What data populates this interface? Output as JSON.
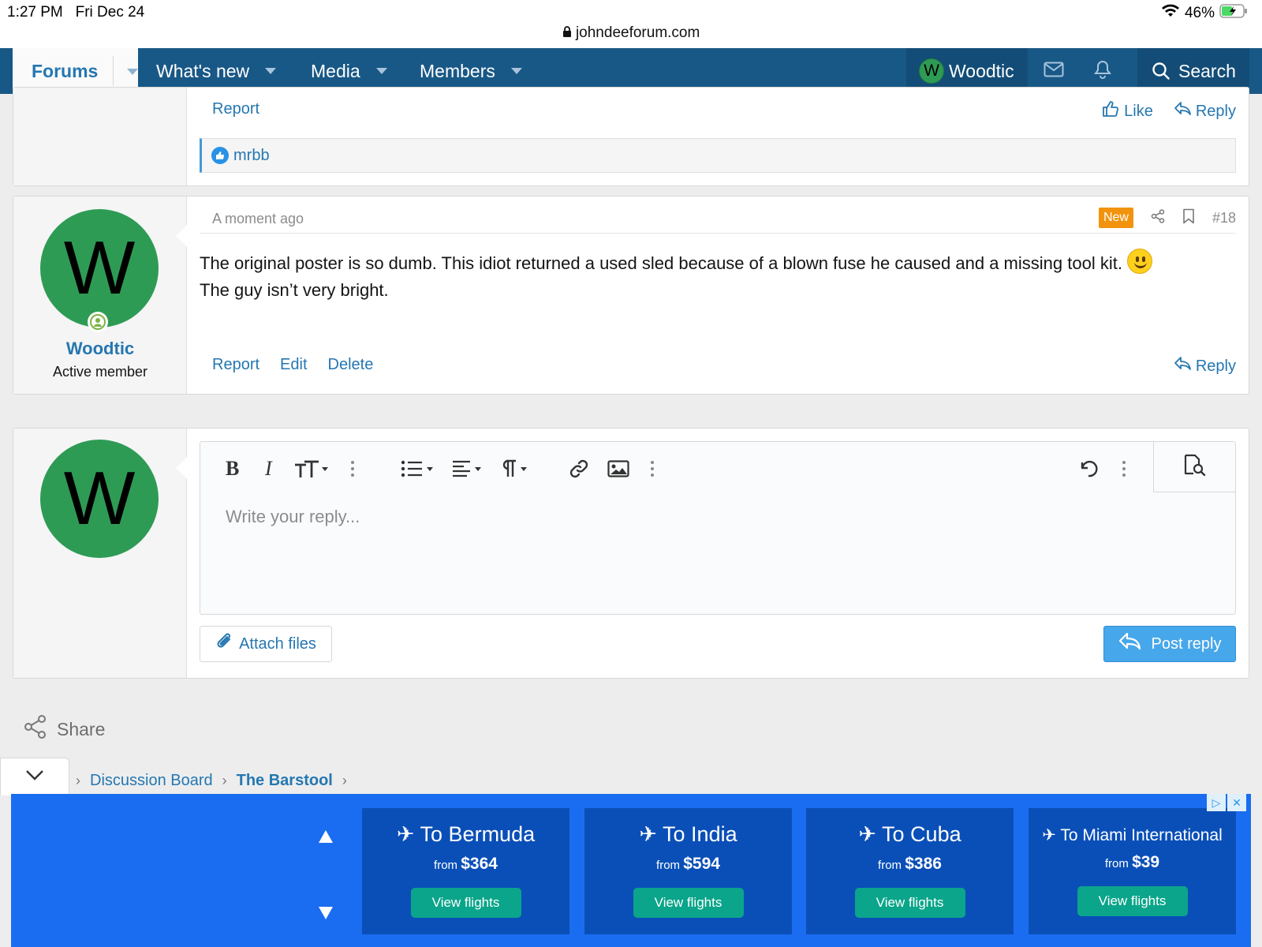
{
  "status": {
    "time": "1:27 PM",
    "date": "Fri Dec 24",
    "url": "johndeeforum.com",
    "battery": "46%"
  },
  "nav": {
    "forums": "Forums",
    "whats_new": "What's new",
    "media": "Media",
    "members": "Members",
    "user_initial": "W",
    "user_name": "Woodtic",
    "search": "Search"
  },
  "prev_post": {
    "report": "Report",
    "like": "Like",
    "reply": "Reply",
    "reactor": "mrbb"
  },
  "post": {
    "avatar_initial": "W",
    "username": "Woodtic",
    "user_title": "Active member",
    "time": "A moment ago",
    "badge": "New",
    "number": "#18",
    "text": "The original poster is so dumb. This idiot returned a used sled because of a blown fuse he caused and a missing tool kit.",
    "text2": "The guy isn’t very bright.",
    "report": "Report",
    "edit": "Edit",
    "delete": "Delete",
    "reply": "Reply"
  },
  "reply_box": {
    "avatar_initial": "W",
    "placeholder": "Write your reply...",
    "attach": "Attach files",
    "post_reply": "Post reply"
  },
  "share": "Share",
  "breadcrumbs": [
    "Discussion Board",
    "The Barstool"
  ],
  "ad": {
    "cards": [
      {
        "dest": "To Bermuda",
        "from": "from",
        "price": "$364",
        "cta": "View flights"
      },
      {
        "dest": "To India",
        "from": "from",
        "price": "$594",
        "cta": "View flights"
      },
      {
        "dest": "To Cuba",
        "from": "from",
        "price": "$386",
        "cta": "View flights"
      },
      {
        "dest": "To Miami International",
        "from": "from",
        "price": "$39",
        "cta": "View flights"
      }
    ]
  }
}
